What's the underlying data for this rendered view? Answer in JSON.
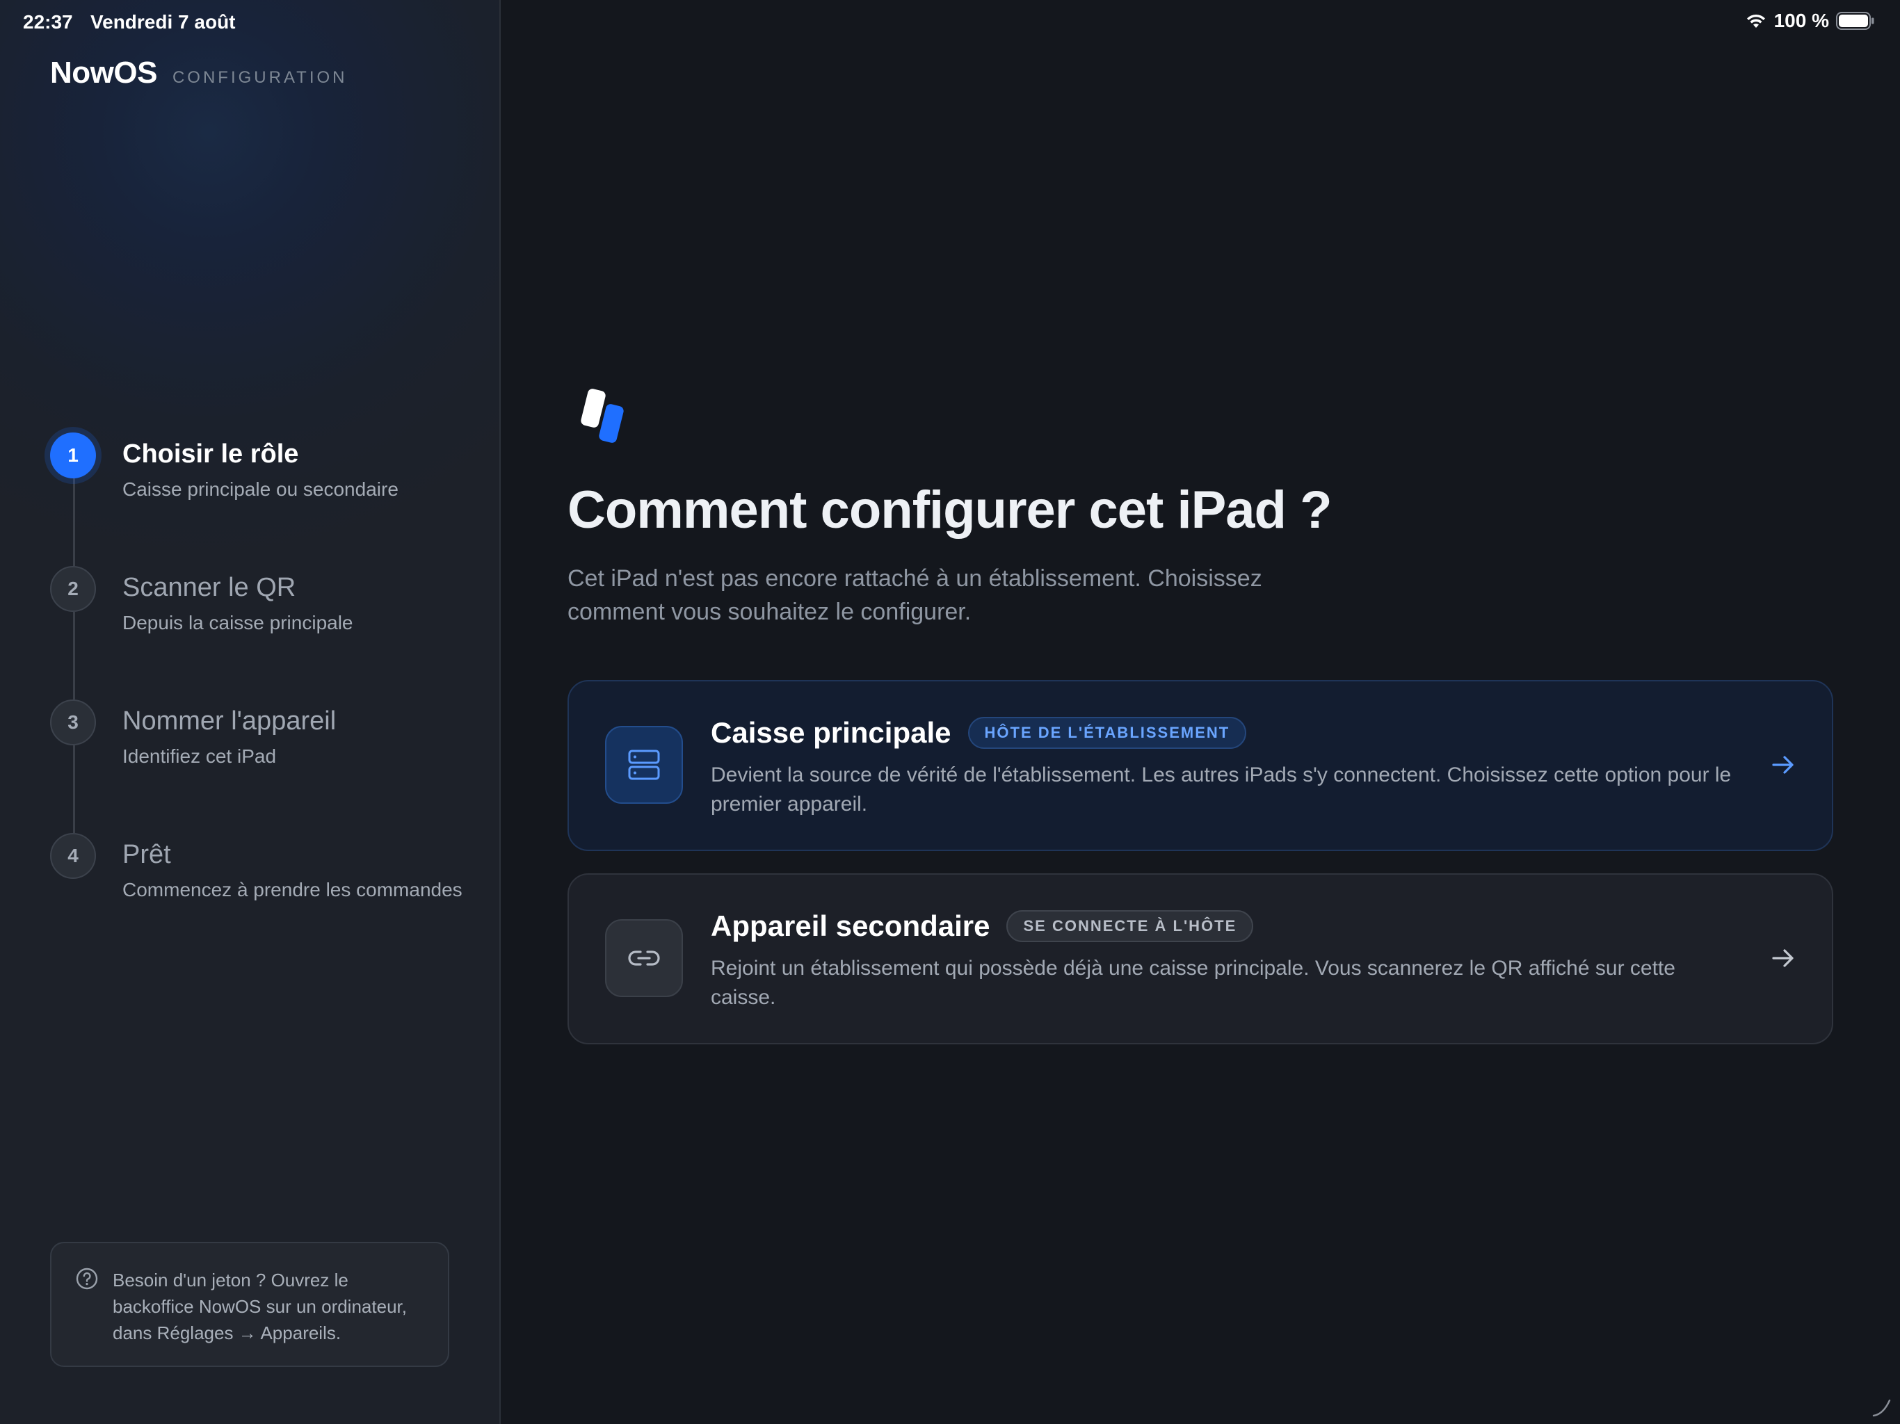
{
  "status_bar": {
    "time": "22:37",
    "date": "Vendredi 7 août",
    "battery": "100 %"
  },
  "sidebar": {
    "brand": "NowOS",
    "brand_sub": "CONFIGURATION",
    "steps": [
      {
        "number": "1",
        "title": "Choisir le rôle",
        "desc": "Caisse principale ou secondaire",
        "state": "active"
      },
      {
        "number": "2",
        "title": "Scanner le QR",
        "desc": "Depuis la caisse principale",
        "state": "idle"
      },
      {
        "number": "3",
        "title": "Nommer l'appareil",
        "desc": "Identifiez cet iPad",
        "state": "idle"
      },
      {
        "number": "4",
        "title": "Prêt",
        "desc": "Commencez à prendre les commandes",
        "state": "idle"
      }
    ],
    "help_text": "Besoin d'un jeton ? Ouvrez le backoffice NowOS sur un ordinateur, dans Réglages → Appareils."
  },
  "main": {
    "title": "Comment configurer cet iPad ?",
    "subtitle": "Cet iPad n'est pas encore rattaché à un établissement. Choisissez comment vous souhaitez le configurer.",
    "options": [
      {
        "title": "Caisse principale",
        "badge": "HÔTE DE L'ÉTABLISSEMENT",
        "desc": "Devient la source de vérité de l'établissement. Les autres iPads s'y connectent. Choisissez cette option pour le premier appareil.",
        "icon": "server-icon"
      },
      {
        "title": "Appareil secondaire",
        "badge": "SE CONNECTE À L'HÔTE",
        "desc": "Rejoint un établissement qui possède déjà une caisse principale. Vous scannerez le QR affiché sur cette caisse.",
        "icon": "link-icon"
      }
    ]
  },
  "colors": {
    "accent": "#1f6fff",
    "background": "#14171d",
    "sidebar": "#1d2129"
  }
}
